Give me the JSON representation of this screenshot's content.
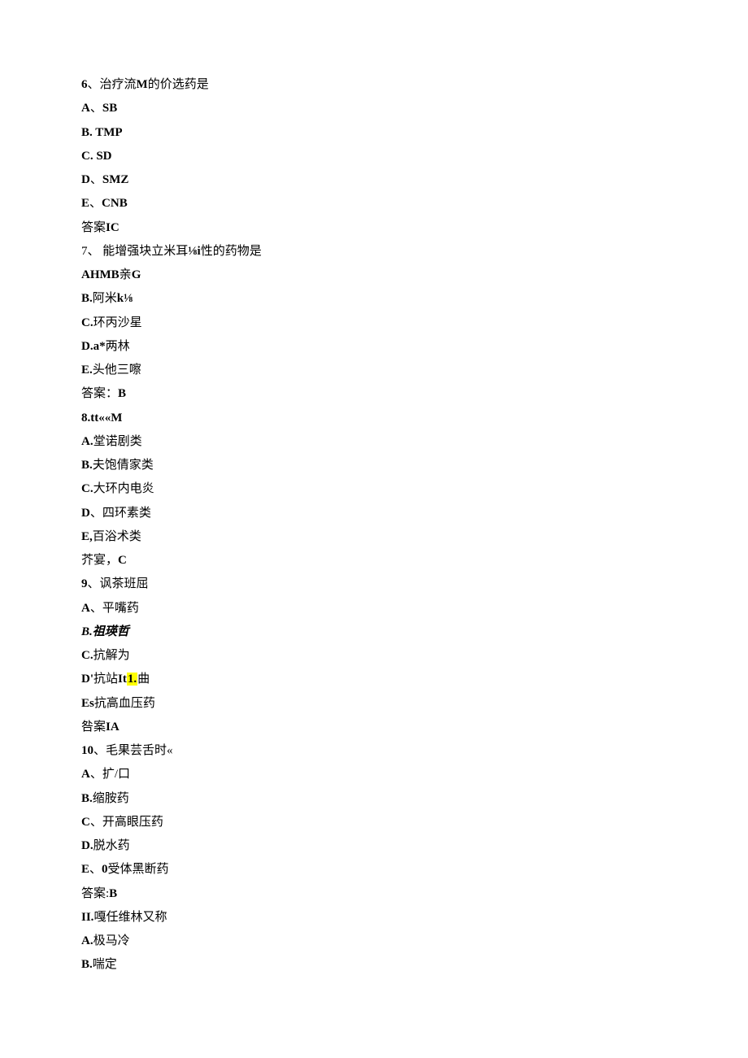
{
  "lines": [
    {
      "segments": [
        {
          "text": "6",
          "bold": true
        },
        {
          "text": "、治疗流"
        },
        {
          "text": "M",
          "bold": true
        },
        {
          "text": "的价选药是"
        }
      ]
    },
    {
      "segments": [
        {
          "text": "A",
          "bold": true
        },
        {
          "text": "、"
        },
        {
          "text": "SB",
          "bold": true
        }
      ]
    },
    {
      "segments": [
        {
          "text": "B.   TMP",
          "bold": true
        }
      ]
    },
    {
      "segments": [
        {
          "text": "C.   SD",
          "bold": true
        }
      ]
    },
    {
      "segments": [
        {
          "text": "D",
          "bold": true
        },
        {
          "text": "、"
        },
        {
          "text": "SMZ",
          "bold": true
        }
      ]
    },
    {
      "segments": [
        {
          "text": "E",
          "bold": true
        },
        {
          "text": "、"
        },
        {
          "text": "CNB",
          "bold": true
        }
      ]
    },
    {
      "segments": [
        {
          "text": "答案"
        },
        {
          "text": "IC",
          "bold": true
        }
      ]
    },
    {
      "segments": [
        {
          "text": "7、 能增强块立米耳"
        },
        {
          "text": "⅛i",
          "bold": true
        },
        {
          "text": "性的药物是"
        }
      ]
    },
    {
      "segments": [
        {
          "text": "AHMB",
          "bold": true
        },
        {
          "text": "亲"
        },
        {
          "text": "G",
          "bold": true
        }
      ]
    },
    {
      "segments": [
        {
          "text": "B.",
          "bold": true
        },
        {
          "text": "阿米"
        },
        {
          "text": "k⅛",
          "bold": true
        }
      ]
    },
    {
      "segments": [
        {
          "text": "C.",
          "bold": true
        },
        {
          "text": "环丙沙星"
        }
      ]
    },
    {
      "segments": [
        {
          "text": "D.a*",
          "bold": true
        },
        {
          "text": "两林"
        }
      ]
    },
    {
      "segments": [
        {
          "text": "E.",
          "bold": true
        },
        {
          "text": "头他三嚓"
        }
      ]
    },
    {
      "segments": [
        {
          "text": "答案："
        },
        {
          "text": "B",
          "bold": true
        }
      ]
    },
    {
      "segments": [
        {
          "text": "8.tt««M",
          "bold": true
        }
      ]
    },
    {
      "segments": [
        {
          "text": "A.",
          "bold": true
        },
        {
          "text": "堂诺剧类"
        }
      ]
    },
    {
      "segments": [
        {
          "text": "B.",
          "bold": true
        },
        {
          "text": "夫饱倩家类"
        }
      ]
    },
    {
      "segments": [
        {
          "text": "C.",
          "bold": true
        },
        {
          "text": "大环内电炎"
        }
      ]
    },
    {
      "segments": [
        {
          "text": "D",
          "bold": true
        },
        {
          "text": "、四环素类"
        }
      ]
    },
    {
      "segments": [
        {
          "text": "E,",
          "bold": true
        },
        {
          "text": "百浴术类"
        }
      ]
    },
    {
      "segments": [
        {
          "text": "芥宴，"
        },
        {
          "text": "C",
          "bold": true
        }
      ]
    },
    {
      "segments": [
        {
          "text": "9",
          "bold": true
        },
        {
          "text": "、讽茶班屈"
        }
      ]
    },
    {
      "segments": [
        {
          "text": "A",
          "bold": true
        },
        {
          "text": "、平嘴药"
        }
      ]
    },
    {
      "segments": [
        {
          "text": "B.祖瑛哲",
          "boldItalic": true
        }
      ]
    },
    {
      "segments": [
        {
          "text": "C.",
          "bold": true
        },
        {
          "text": "抗解为"
        }
      ]
    },
    {
      "segments": [
        {
          "text": "D'",
          "bold": true
        },
        {
          "text": "抗站"
        },
        {
          "text": "It",
          "bold": true
        },
        {
          "text": "1.",
          "bold": true,
          "highlight": true
        },
        {
          "text": "曲"
        }
      ]
    },
    {
      "segments": [
        {
          "text": "Es",
          "bold": true
        },
        {
          "text": "抗高血压药"
        }
      ]
    },
    {
      "segments": [
        {
          "text": "咎案"
        },
        {
          "text": "IA",
          "bold": true
        }
      ]
    },
    {
      "segments": [
        {
          "text": "10",
          "bold": true
        },
        {
          "text": "、毛果芸舌时«"
        }
      ]
    },
    {
      "segments": [
        {
          "text": "A",
          "bold": true
        },
        {
          "text": "、扩/口"
        }
      ]
    },
    {
      "segments": [
        {
          "text": "B.",
          "bold": true
        },
        {
          "text": "缩胺药"
        }
      ]
    },
    {
      "segments": [
        {
          "text": "C",
          "bold": true
        },
        {
          "text": "、开高眼压药"
        }
      ]
    },
    {
      "segments": [
        {
          "text": "D.",
          "bold": true
        },
        {
          "text": "脱水药"
        }
      ]
    },
    {
      "segments": [
        {
          "text": "E",
          "bold": true
        },
        {
          "text": "、"
        },
        {
          "text": "0",
          "bold": true
        },
        {
          "text": "受体黑断药"
        }
      ]
    },
    {
      "segments": [
        {
          "text": "答案:"
        },
        {
          "text": "B",
          "bold": true
        }
      ]
    },
    {
      "segments": [
        {
          "text": "II.",
          "bold": true
        },
        {
          "text": "嘎任维林又称"
        }
      ]
    },
    {
      "segments": [
        {
          "text": "A.",
          "bold": true
        },
        {
          "text": "极马冷"
        }
      ]
    },
    {
      "segments": [
        {
          "text": "B.",
          "bold": true
        },
        {
          "text": "喘定"
        }
      ]
    }
  ]
}
